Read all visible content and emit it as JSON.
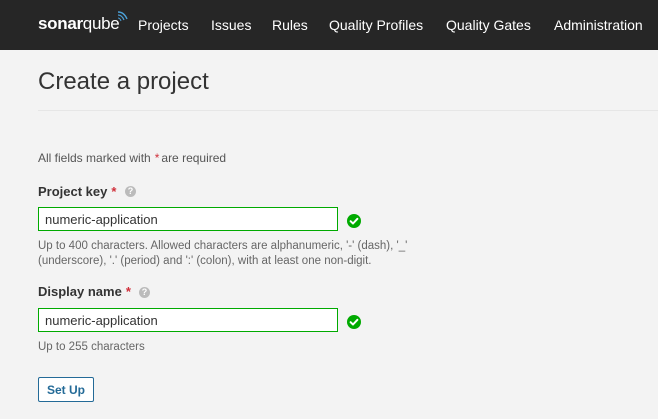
{
  "header": {
    "logo": {
      "part1": "sonar",
      "part2": "qube"
    },
    "nav": [
      {
        "label": "Projects"
      },
      {
        "label": "Issues"
      },
      {
        "label": "Rules"
      },
      {
        "label": "Quality Profiles"
      },
      {
        "label": "Quality Gates"
      },
      {
        "label": "Administration"
      }
    ]
  },
  "page": {
    "title": "Create a project",
    "required_note": {
      "before": "All fields marked with",
      "star": "*",
      "after": "are required"
    }
  },
  "form": {
    "project_key": {
      "label": "Project key",
      "star": "*",
      "help": "?",
      "value": "numeric-application",
      "hint_lines": [
        "Up to 400 characters. Allowed characters are alphanumeric, '-' (dash), '_'",
        "(underscore), '.' (period) and ':' (colon), with at least one non-digit."
      ]
    },
    "display_name": {
      "label": "Display name",
      "star": "*",
      "help": "?",
      "value": "numeric-application",
      "hint": "Up to 255 characters"
    },
    "submit_label": "Set Up"
  },
  "colors": {
    "header_bg": "#262626",
    "valid_border": "#00aa00",
    "valid_icon": "#00aa00",
    "required_star": "#d02f3a",
    "button": "#236a97"
  },
  "icons": {
    "logo_wave": "sonar-waves-icon",
    "help": "help-icon",
    "valid": "check-circle-icon"
  }
}
